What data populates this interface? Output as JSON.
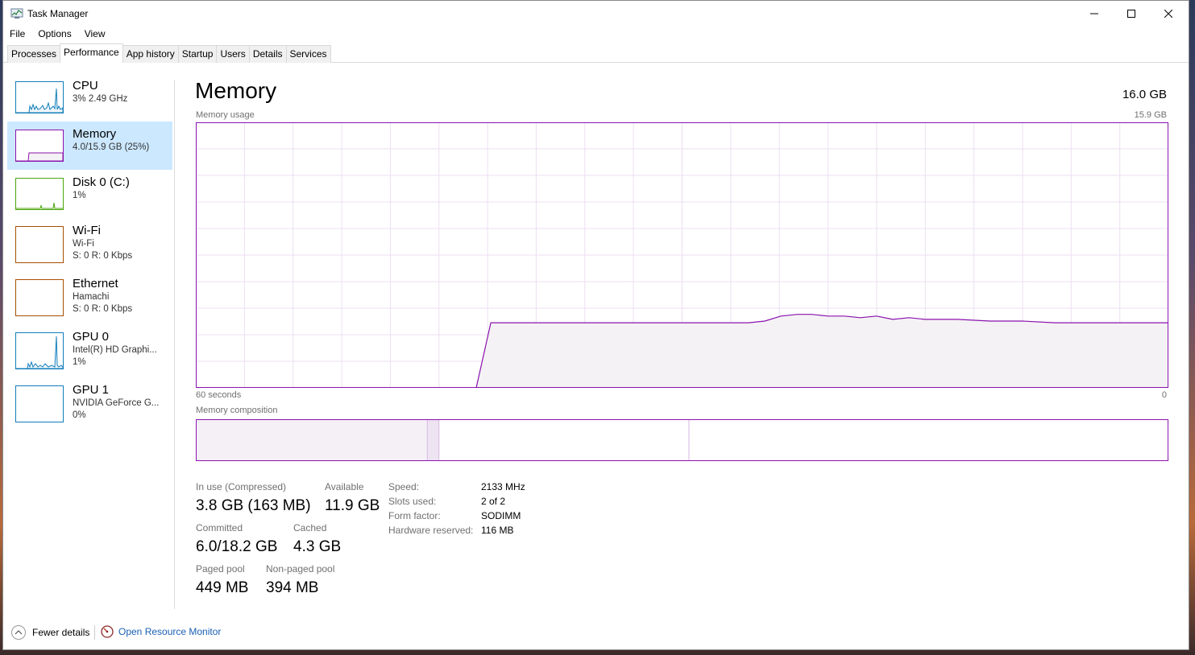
{
  "window": {
    "title": "Task Manager"
  },
  "menu": [
    "File",
    "Options",
    "View"
  ],
  "tabs": [
    "Processes",
    "Performance",
    "App history",
    "Startup",
    "Users",
    "Details",
    "Services"
  ],
  "active_tab": "Performance",
  "sidebar": {
    "items": [
      {
        "name": "CPU",
        "lines": [
          "3% 2.49 GHz"
        ],
        "color": "#117dbb"
      },
      {
        "name": "Memory",
        "lines": [
          "4.0/15.9 GB (25%)"
        ],
        "color": "#8b12ae"
      },
      {
        "name": "Disk 0 (C:)",
        "lines": [
          "1%"
        ],
        "color": "#4da60c"
      },
      {
        "name": "Wi-Fi",
        "lines": [
          "Wi-Fi",
          "S: 0 R: 0 Kbps"
        ],
        "color": "#a74f01"
      },
      {
        "name": "Ethernet",
        "lines": [
          "Hamachi",
          "S: 0 R: 0 Kbps"
        ],
        "color": "#a74f01"
      },
      {
        "name": "GPU 0",
        "lines": [
          "Intel(R) HD Graphi...",
          "1%"
        ],
        "color": "#117dbb"
      },
      {
        "name": "GPU 1",
        "lines": [
          "NVIDIA GeForce G...",
          "0%"
        ],
        "color": "#117dbb"
      }
    ]
  },
  "main": {
    "title": "Memory",
    "total": "16.0 GB",
    "usage_label": "Memory usage",
    "usage_max": "15.9 GB",
    "time_left": "60 seconds",
    "time_right": "0",
    "composition_label": "Memory composition",
    "accent_color": "#8b12ae",
    "fill_color": "#f4f2f4"
  },
  "chart_data": {
    "type": "area",
    "title": "Memory usage",
    "xlabel": "60 seconds",
    "ylabel": "",
    "xlim": [
      60,
      0
    ],
    "ylim": [
      0,
      15.9
    ],
    "x": [
      60,
      42.7,
      41.8,
      33.3,
      25.9,
      24.9,
      23.9,
      22.9,
      22.0,
      21.0,
      20.0,
      19.0,
      18.0,
      17.0,
      16.0,
      15.0,
      14.0,
      13.0,
      11.0,
      9.0,
      7.0,
      5.0,
      3.0,
      1.0,
      0
    ],
    "series": [
      {
        "values": [
          0,
          0,
          3.9,
          3.9,
          3.9,
          4.0,
          4.3,
          4.4,
          4.4,
          4.3,
          4.3,
          4.2,
          4.3,
          4.1,
          4.2,
          4.1,
          4.1,
          4.1,
          4.0,
          4.0,
          3.9,
          3.9,
          3.9,
          3.9,
          3.9
        ]
      }
    ],
    "grid": true
  },
  "composition": {
    "in_use_fraction": 0.238,
    "modified_fraction": 0.012,
    "standby_fraction": 0.257
  },
  "stats": {
    "in_use_label": "In use (Compressed)",
    "in_use_value": "3.8 GB (163 MB)",
    "available_label": "Available",
    "available_value": "11.9 GB",
    "committed_label": "Committed",
    "committed_value": "6.0/18.2 GB",
    "cached_label": "Cached",
    "cached_value": "4.3 GB",
    "paged_label": "Paged pool",
    "paged_value": "449 MB",
    "nonpaged_label": "Non-paged pool",
    "nonpaged_value": "394 MB"
  },
  "specs": {
    "speed_label": "Speed:",
    "speed_value": "2133 MHz",
    "slots_label": "Slots used:",
    "slots_value": "2 of 2",
    "form_label": "Form factor:",
    "form_value": "SODIMM",
    "reserved_label": "Hardware reserved:",
    "reserved_value": "116 MB"
  },
  "footer": {
    "fewer_details": "Fewer details",
    "open_resource_monitor": "Open Resource Monitor"
  }
}
